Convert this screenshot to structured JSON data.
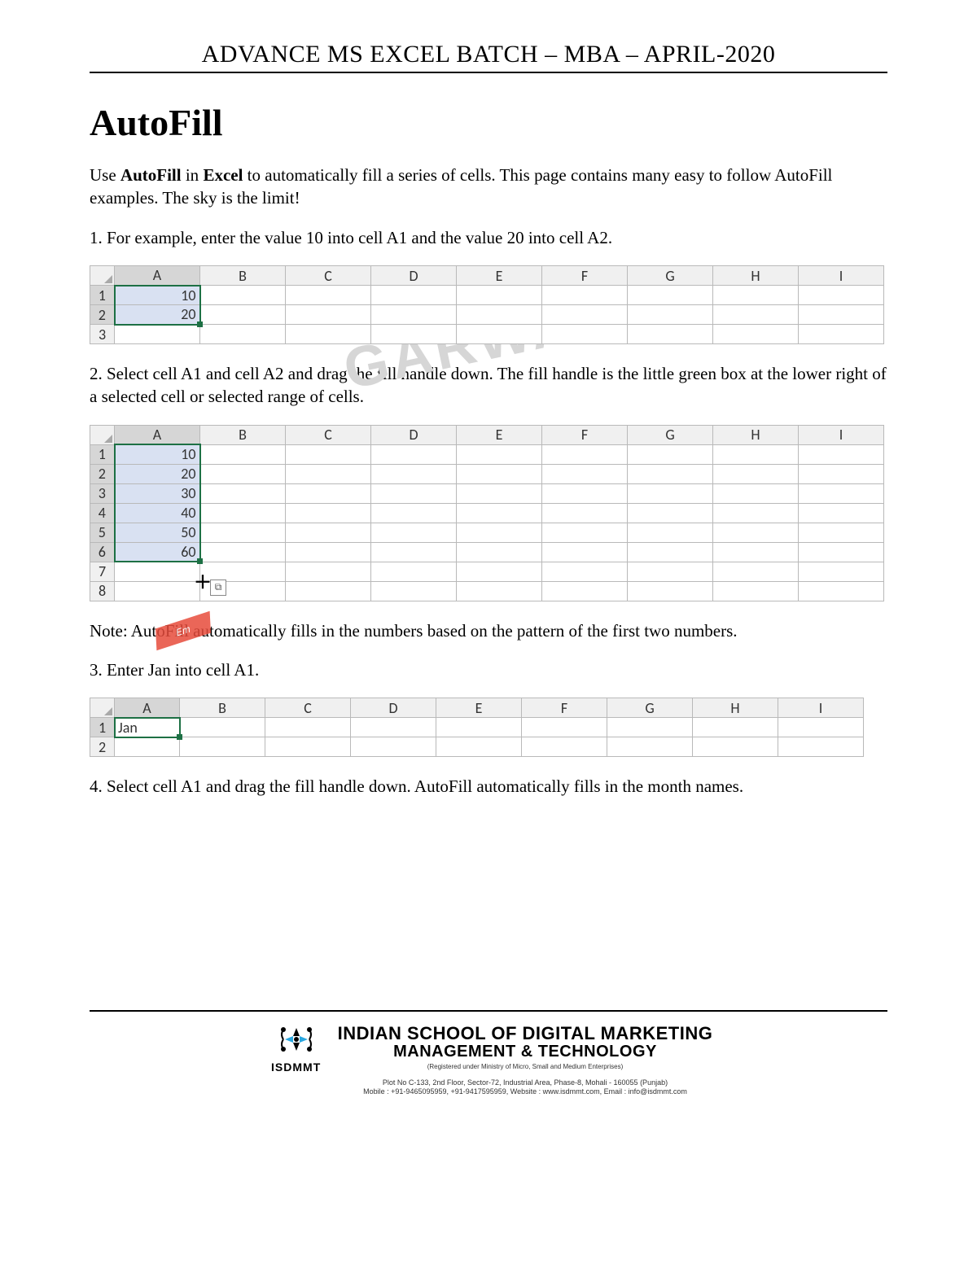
{
  "header": "ADVANCE MS EXCEL BATCH – MBA – APRIL-2020",
  "title": "AutoFill",
  "intro_pre": "Use ",
  "intro_bold1": "AutoFill",
  "intro_mid1": " in ",
  "intro_bold2": "Excel",
  "intro_post": " to automatically fill a series of cells. This page contains many easy to follow AutoFill examples. The sky is the limit!",
  "step1": "1. For example, enter the value 10 into cell A1 and the value 20 into cell A2.",
  "step2": "2. Select cell A1 and cell A2 and drag the fill handle down. The fill handle is the little green box at the lower right of a selected cell or selected range of cells.",
  "note": "Note: AutoFill automatically fills in the numbers based on the pattern of the first two numbers.",
  "step3": "3. Enter Jan into cell A1.",
  "step4": "4. Select cell A1 and drag the fill handle down. AutoFill automatically fills in the month names.",
  "watermark": "GARWAL",
  "stamp": "Em",
  "cols": [
    "A",
    "B",
    "C",
    "D",
    "E",
    "F",
    "G",
    "H",
    "I"
  ],
  "table1": {
    "rows": [
      "1",
      "2",
      "3"
    ],
    "A1": "10",
    "A2": "20"
  },
  "table2": {
    "rows": [
      "1",
      "2",
      "3",
      "4",
      "5",
      "6",
      "7",
      "8"
    ],
    "A": [
      "10",
      "20",
      "30",
      "40",
      "50",
      "60",
      "",
      ""
    ]
  },
  "table3": {
    "rows": [
      "1",
      "2"
    ],
    "A1": "Jan"
  },
  "footer": {
    "brand": "ISDMMT",
    "name1": "INDIAN SCHOOL OF DIGITAL MARKETING",
    "name2": "MANAGEMENT & TECHNOLOGY",
    "reg": "(Registered under Ministry of Micro, Small and Medium Enterprises)",
    "addr1": "Plot No C-133, 2nd Floor, Sector-72, Industrial Area, Phase-8, Mohali - 160055 (Punjab)",
    "addr2": "Mobile : +91-9465095959, +91-9417595959, Website : www.isdmmt.com, Email : info@isdmmt.com"
  }
}
